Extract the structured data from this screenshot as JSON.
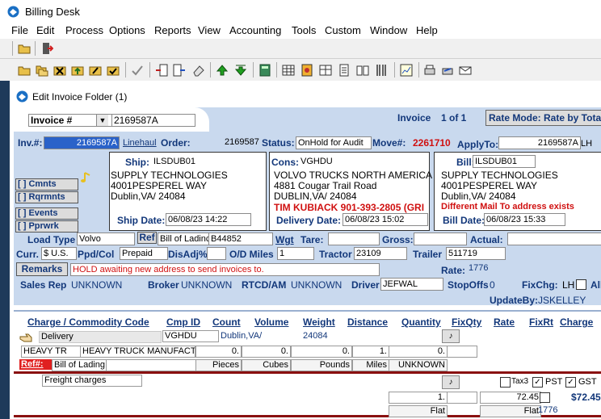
{
  "app": {
    "title": "Billing Desk"
  },
  "menu": [
    "File",
    "Edit",
    "Process",
    "Options",
    "Reports",
    "View",
    "Accounting",
    "Tools",
    "Custom",
    "Window",
    "Help"
  ],
  "window": {
    "title": "Edit Invoice Folder (1)"
  },
  "header": {
    "search_type": "Invoice #",
    "search_value": "2169587A",
    "invoice_label": "Invoice",
    "invoice_count": "1 of 1",
    "rate_mode": "Rate Mode: Rate by Tota"
  },
  "row1": {
    "inv_label": "Inv.#:",
    "inv_value": "2169587A",
    "inv_type": "Linehaul",
    "order_label": "Order:",
    "order_value": "2169587",
    "status_label": "Status:",
    "status_value": "OnHold for Audit",
    "move_label": "Move#:",
    "move_value": "2261710",
    "applyto_label": "ApplyTo:",
    "applyto_value": "2169587A",
    "applyto_suffix": "LH"
  },
  "ship": {
    "label": "Ship:",
    "code": "ILSDUB01",
    "name": "SUPPLY TECHNOLOGIES",
    "addr1": "4001PESPEREL WAY",
    "addr2": "Dublin,VA/ 24084",
    "date_label": "Ship Date:",
    "date": "06/08/23 14:22"
  },
  "cons": {
    "label": "Cons:",
    "code": "VGHDU",
    "name": "VOLVO TRUCKS NORTH AMERICA",
    "addr1": "4881 Cougar Trail Road",
    "addr2": "DUBLIN,VA/ 24084",
    "contact": "TIM KUBIACK 901-393-2805 (GRI",
    "date_label": "Delivery Date:",
    "date": "06/08/23 15:02"
  },
  "bill": {
    "label": "Bill:",
    "code": "ILSDUB01",
    "name": "SUPPLY TECHNOLOGIES",
    "addr1": "4001PESPEREL WAY",
    "addr2": "Dublin,VA/ 24084",
    "note": "Different Mail To address exists",
    "date_label": "Bill Date:",
    "date": "06/08/23 15:33"
  },
  "side_buttons": [
    "[ ] Cmnts",
    "[ ] Rqrmnts",
    "[ ] Events",
    "[ ] Pprwrk"
  ],
  "row_load": {
    "load_label": "Load Type",
    "load_value": "Volvo",
    "ref_label": "Ref",
    "ref_type": "Bill of Ladinc",
    "ref_value": "B44852",
    "wgt_label": "Wgt",
    "tare_label": "Tare:",
    "gross_label": "Gross:",
    "actual_label": "Actual:"
  },
  "row_curr": {
    "curr_label": "Curr.",
    "curr_value": "$ U.S.",
    "ppd_label": "Ppd/Col",
    "ppd_value": "Prepaid",
    "disadj_label": "DisAdj%",
    "miles_label": "O/D Miles",
    "miles_value": "1",
    "tractor_label": "Tractor",
    "tractor_value": "23109",
    "trailer_label": "Trailer",
    "trailer_value": "511719"
  },
  "remarks": {
    "button": "Remarks",
    "text": "HOLD awaiting new address to send invoices to.",
    "rate_label": "Rate:",
    "rate_value": "1776"
  },
  "row_sales": {
    "sales_label": "Sales Rep",
    "sales_value": "UNKNOWN",
    "broker_label": "Broker",
    "broker_value": "UNKNOWN",
    "rtcd_label": "RTCD/AM",
    "rtcd_value": "UNKNOWN",
    "driver_label": "Driver",
    "driver_value": "JEFWAL",
    "stopoffs_label": "StopOffs",
    "stopoffs_value": "0",
    "fixchg_label": "FixChg:",
    "fixchg_value": "LH",
    "all_label": "All",
    "updateby_label": "UpdateBy:",
    "updateby_value": "JSKELLEY"
  },
  "grid_headers": [
    "Charge / Commodity Code",
    "Cmp ID",
    "Count",
    "Volume",
    "Weight",
    "Distance",
    "Quantity",
    "FixQty",
    "Rate",
    "FixRt",
    "Charge"
  ],
  "delivery": {
    "label": "Delivery",
    "cmp": "VGHDU",
    "city": "Dublin,VA/",
    "zip": "24084"
  },
  "commodity": {
    "code": "HEAVY TR",
    "desc": "HEAVY TRUCK MANUFACT",
    "count": "0.",
    "volume": "0.",
    "weight": "0.",
    "distance": "1.",
    "quantity": "0.",
    "count_unit": "Pieces",
    "volume_unit": "Cubes",
    "weight_unit": "Pounds",
    "distance_unit": "Miles",
    "quantity_unit": "UNKNOWN"
  },
  "ref_row": {
    "label": "Ref#:",
    "type": "Bill of Lading"
  },
  "freight": {
    "desc": "Freight charges",
    "tax3": "Tax3",
    "pst": "PST",
    "gst": "GST",
    "quantity": "1.",
    "rate": "72.45",
    "charge": "$72.45",
    "unit1": "Flat",
    "unit2": "Flat",
    "rate2": "1776"
  }
}
